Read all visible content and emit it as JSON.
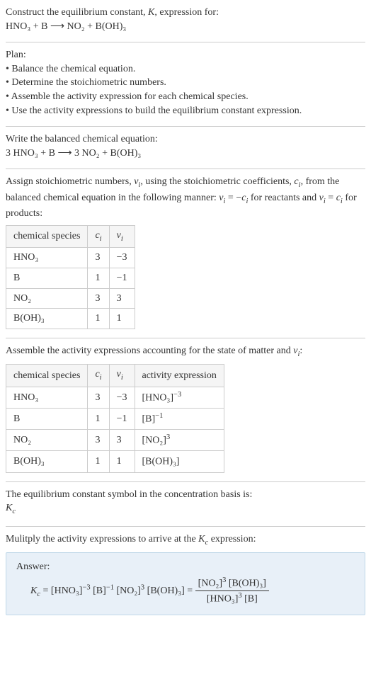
{
  "prompt": {
    "line1": "Construct the equilibrium constant, ",
    "K": "K",
    "line1_end": ", expression for:",
    "equation": "HNO₃ + B ⟶ NO₂ + B(OH)₃"
  },
  "plan": {
    "title": "Plan:",
    "items": [
      "• Balance the chemical equation.",
      "• Determine the stoichiometric numbers.",
      "• Assemble the activity expression for each chemical species.",
      "• Use the activity expressions to build the equilibrium constant expression."
    ]
  },
  "balanced": {
    "title": "Write the balanced chemical equation:",
    "equation": "3 HNO₃ + B ⟶ 3 NO₂ + B(OH)₃"
  },
  "stoich": {
    "intro_a": "Assign stoichiometric numbers, ",
    "nu": "ν",
    "i": "i",
    "intro_b": ", using the stoichiometric coefficients, ",
    "c": "c",
    "intro_c": ", from the balanced chemical equation in the following manner: ",
    "rel1a": "ν",
    "rel1b": " = −",
    "rel1c": "c",
    "rel1d": " for reactants and ",
    "rel2a": "ν",
    "rel2b": " = ",
    "rel2c": "c",
    "rel2d": " for products:",
    "headers": {
      "species": "chemical species",
      "ci": "c",
      "vi": "ν"
    },
    "rows": [
      {
        "species": "HNO₃",
        "ci": "3",
        "vi": "−3"
      },
      {
        "species": "B",
        "ci": "1",
        "vi": "−1"
      },
      {
        "species": "NO₂",
        "ci": "3",
        "vi": "3"
      },
      {
        "species": "B(OH)₃",
        "ci": "1",
        "vi": "1"
      }
    ]
  },
  "activity": {
    "intro_a": "Assemble the activity expressions accounting for the state of matter and ",
    "nu": "ν",
    "i": "i",
    "intro_b": ":",
    "headers": {
      "species": "chemical species",
      "ci": "c",
      "vi": "ν",
      "expr": "activity expression"
    },
    "rows": [
      {
        "species": "HNO₃",
        "ci": "3",
        "vi": "−3",
        "expr_base": "[HNO₃]",
        "expr_sup": "−3"
      },
      {
        "species": "B",
        "ci": "1",
        "vi": "−1",
        "expr_base": "[B]",
        "expr_sup": "−1"
      },
      {
        "species": "NO₂",
        "ci": "3",
        "vi": "3",
        "expr_base": "[NO₂]",
        "expr_sup": "3"
      },
      {
        "species": "B(OH)₃",
        "ci": "1",
        "vi": "1",
        "expr_base": "[B(OH)₃]",
        "expr_sup": ""
      }
    ]
  },
  "symbol": {
    "line": "The equilibrium constant symbol in the concentration basis is:",
    "Kc": "K",
    "c": "c"
  },
  "multiply": {
    "line_a": "Mulitply the activity expressions to arrive at the ",
    "Kc": "K",
    "c": "c",
    "line_b": " expression:"
  },
  "answer": {
    "label": "Answer:",
    "lhs_K": "K",
    "lhs_c": "c",
    "eq": " = ",
    "t1_base": "[HNO₃]",
    "t1_sup": "−3",
    "t2_base": " [B]",
    "t2_sup": "−1",
    "t3_base": " [NO₂]",
    "t3_sup": "3",
    "t4_base": " [B(OH)₃]",
    "eq2": " = ",
    "num_a": "[NO₂]",
    "num_a_sup": "3",
    "num_b": " [B(OH)₃]",
    "den_a": "[HNO₃]",
    "den_a_sup": "3",
    "den_b": " [B]"
  }
}
